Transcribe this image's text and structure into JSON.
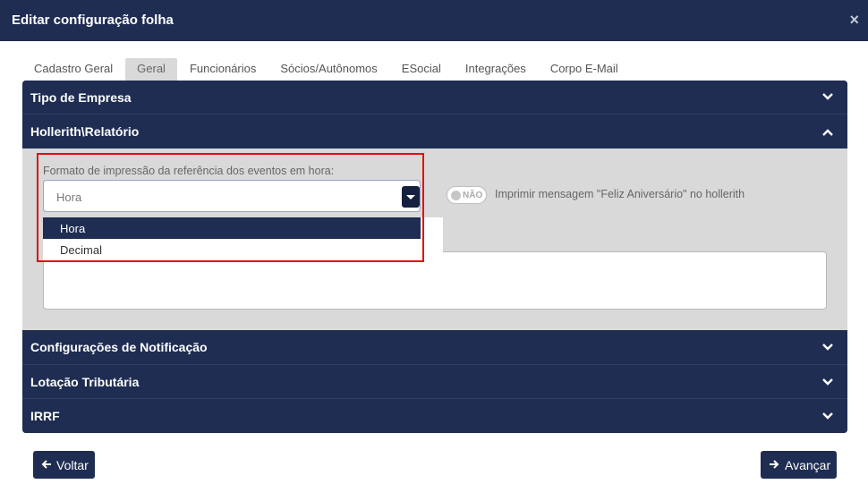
{
  "modal": {
    "title": "Editar configuração folha",
    "close_label": "×"
  },
  "tabs": [
    {
      "label": "Cadastro Geral"
    },
    {
      "label": "Geral"
    },
    {
      "label": "Funcionários"
    },
    {
      "label": "Sócios/Autônomos"
    },
    {
      "label": "ESocial"
    },
    {
      "label": "Integrações"
    },
    {
      "label": "Corpo E-Mail"
    }
  ],
  "active_tab": "Geral",
  "accordion": [
    {
      "label": "Tipo de Empresa",
      "state": "collapsed",
      "icon": "chevron-down-icon"
    },
    {
      "label": "Hollerith\\Relatório",
      "state": "expanded",
      "icon": "chevron-up-icon"
    },
    {
      "label": "Configurações de Notificação",
      "state": "collapsed",
      "icon": "chevron-down-icon"
    },
    {
      "label": "Lotação Tributária",
      "state": "collapsed",
      "icon": "chevron-down-icon"
    },
    {
      "label": "IRRF",
      "state": "collapsed",
      "icon": "chevron-down-icon"
    }
  ],
  "hollerith": {
    "format_label": "Formato de impressão da referência dos eventos em hora:",
    "format_value": "Hora",
    "format_options": [
      "Hora",
      "Decimal"
    ],
    "birthday_toggle_text": "NÃO",
    "birthday_label": "Imprimir mensagem \"Feliz Aniversário\" no hollerith",
    "message_value": ""
  },
  "footer": {
    "back_label": "Voltar",
    "next_label": "Avançar"
  },
  "colors": {
    "navy": "#1f2d52",
    "highlight": "#e01010",
    "panel_body": "#d9d9d9"
  }
}
